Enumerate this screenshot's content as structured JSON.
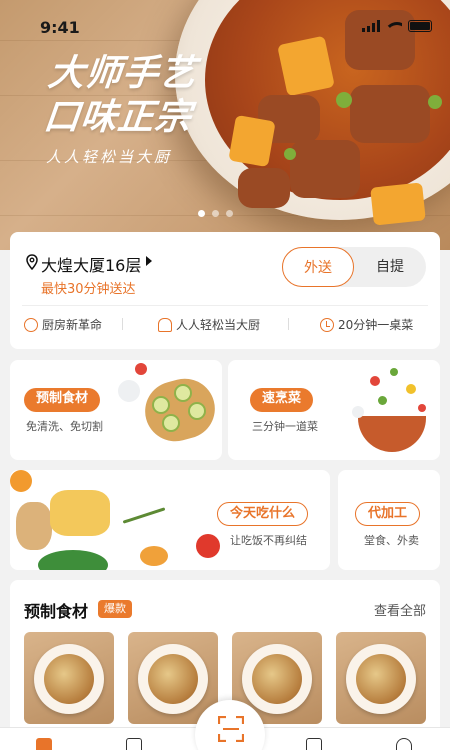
{
  "status_bar": {
    "time": "9:41"
  },
  "hero": {
    "title_line1": "大师手艺",
    "title_line2": "口味正宗",
    "subtitle": "人人轻松当大厨"
  },
  "store": {
    "location": "大煌大厦16层",
    "eta": "最快30分钟送达",
    "mode_options": [
      "外送",
      "自提"
    ],
    "mode_selected": "外送",
    "features": [
      "厨房新革命",
      "人人轻松当大厨",
      "20分钟一桌菜"
    ]
  },
  "categories": [
    {
      "label": "预制食材",
      "sub": "免清洗、免切割"
    },
    {
      "label": "速烹菜",
      "sub": "三分钟一道菜"
    },
    {
      "label": "今天吃什么",
      "sub": "让吃饭不再纠结"
    },
    {
      "label": "代加工",
      "sub": "堂食、外卖"
    }
  ],
  "featured": {
    "title": "预制食材",
    "badge": "爆款",
    "see_all": "查看全部"
  },
  "colors": {
    "accent": "#e8742a",
    "background": "#f2f2f2"
  },
  "icons": [
    "location-pin-icon",
    "kitchen-icon",
    "chef-hat-icon",
    "clock-icon",
    "scan-icon",
    "home-icon"
  ]
}
